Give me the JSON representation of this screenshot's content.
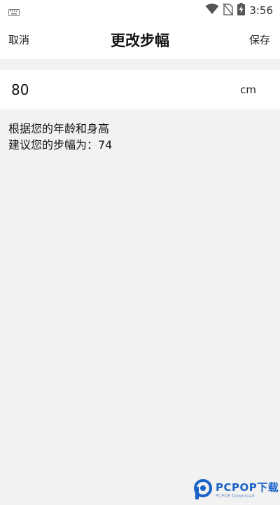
{
  "status_bar": {
    "time": "3:56",
    "icons": [
      "keyboard-icon",
      "wifi-icon",
      "no-sim-icon",
      "battery-charging-icon"
    ]
  },
  "header": {
    "cancel_label": "取消",
    "title": "更改步幅",
    "save_label": "保存"
  },
  "stride_input": {
    "value": "80",
    "unit": "cm"
  },
  "suggestion": {
    "line1": "根据您的年龄和身高",
    "line2": "建议您的步幅为：74"
  },
  "watermark": {
    "brand": "PCPOP下载",
    "sub": "PCPOP Download"
  },
  "colors": {
    "background": "#f2f2f2",
    "surface": "#ffffff",
    "watermark_blue": "#1a63c7"
  }
}
